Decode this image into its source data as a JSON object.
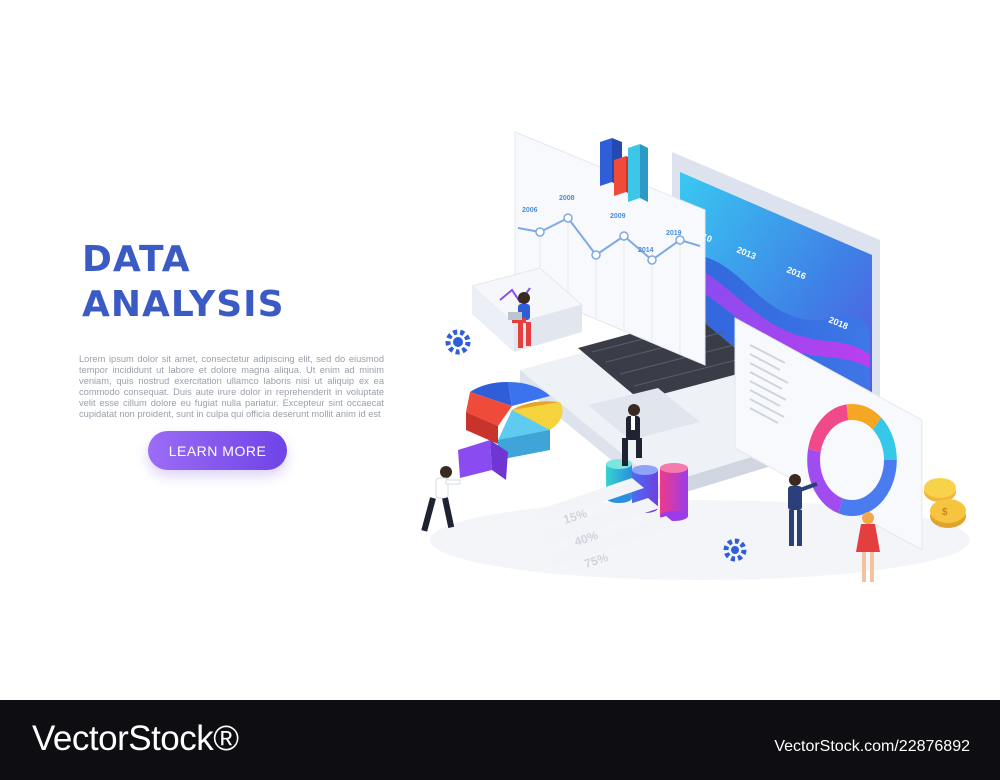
{
  "hero": {
    "title_line1": "DATA",
    "title_line2": "ANALYSIS",
    "body_text": "Lorem ipsum dolor sit amet, consectetur adipiscing elit, sed do eiusmod tempor incididunt ut labore et dolore magna aliqua. Ut enim ad minim veniam, quis nostrud exercitation ullamco laboris nisi ut aliquip ex ea commodo consequat. Duis aute irure dolor in reprehenderit in voluptate velit esse cillum dolore eu fugiat nulla pariatur. Excepteur sint occaecat cupidatat non proident, sunt in culpa qui officia deserunt mollit anim id est",
    "button_label": "LEARN MORE"
  },
  "illustration": {
    "line_chart_years": [
      "2006",
      "2008",
      "2009",
      "2014",
      "2019"
    ],
    "wave_chart_years": [
      "2010",
      "2013",
      "2016",
      "2018"
    ],
    "percentages": [
      "15%",
      "40%",
      "75%"
    ]
  },
  "footer": {
    "logo": "VectorStock®",
    "image_id": "VectorStock.com/22876892"
  },
  "colors": {
    "title": "#3b5bc4",
    "button_start": "#9c6cf5",
    "button_end": "#6e44e6",
    "footer_bg": "#0d0d12"
  }
}
